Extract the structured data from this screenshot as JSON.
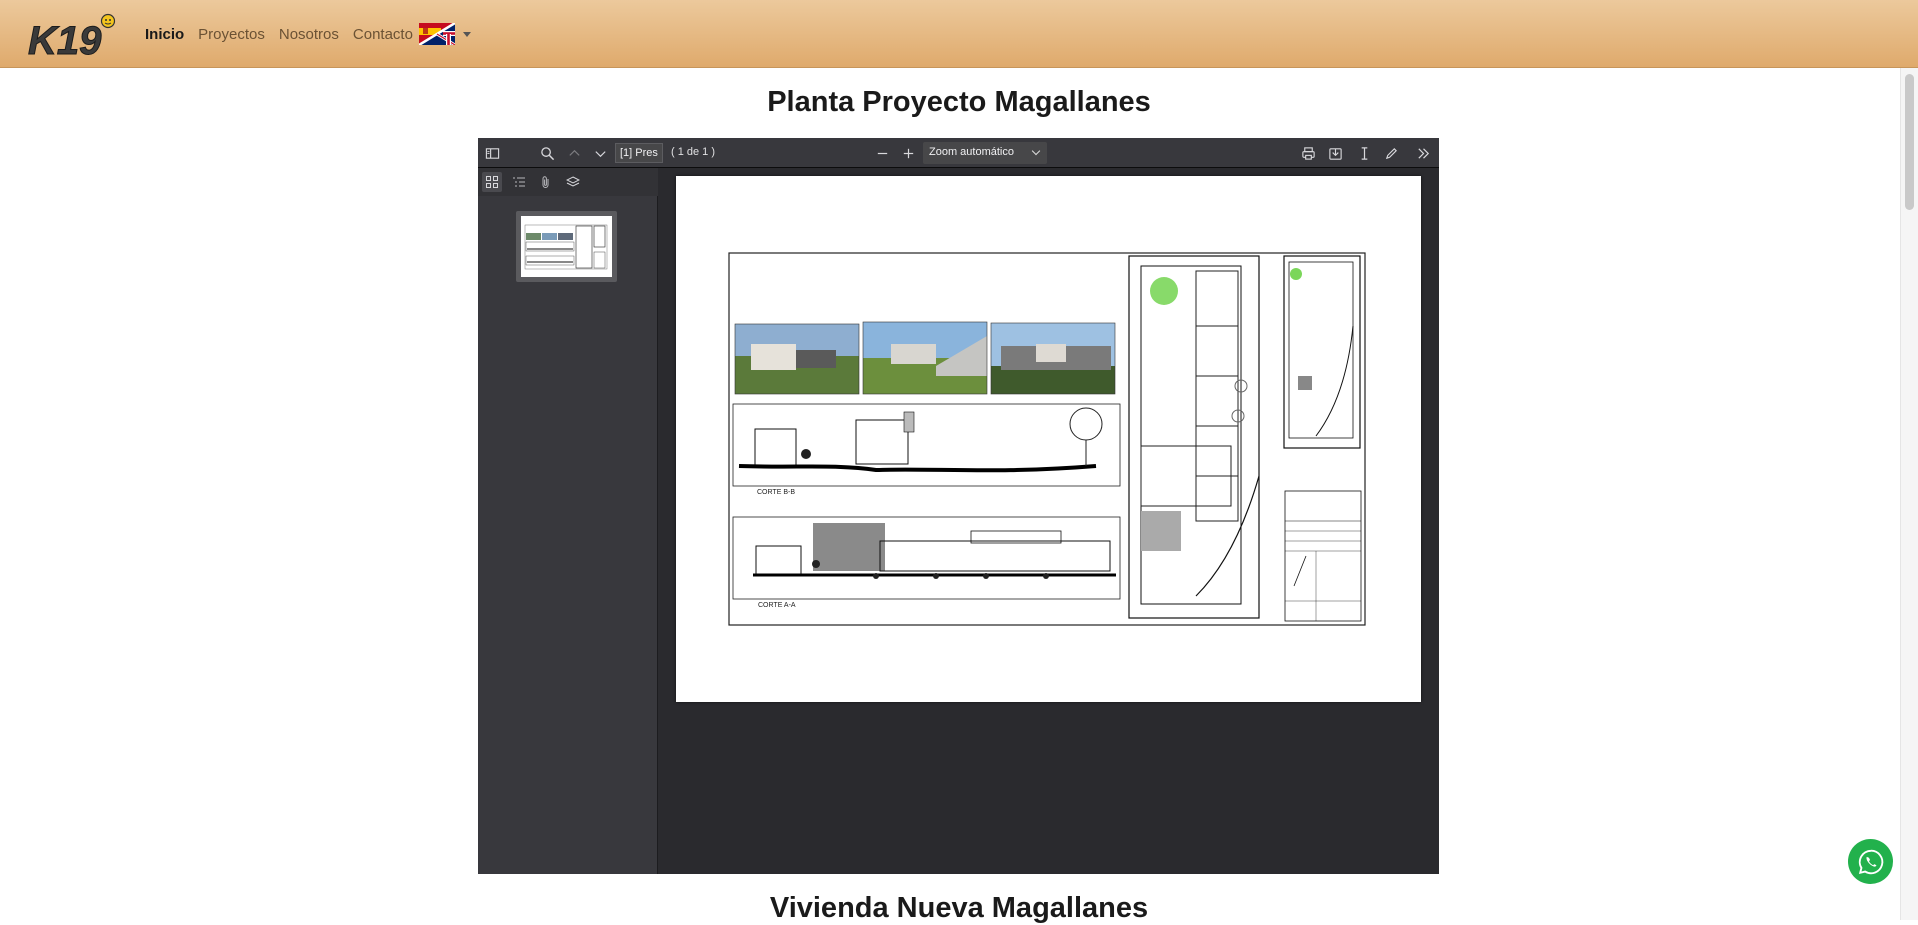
{
  "nav": {
    "logo_text": "K19",
    "links": [
      {
        "label": "Inicio",
        "active": true
      },
      {
        "label": "Proyectos",
        "active": false
      },
      {
        "label": "Nosotros",
        "active": false
      },
      {
        "label": "Contacto",
        "active": false
      }
    ],
    "language_icon": "spain-uk-flag-icon"
  },
  "sections": [
    {
      "title": "Planta Proyecto Magallanes"
    },
    {
      "title": "Vivienda Nueva Magallanes"
    }
  ],
  "pdf_viewer": {
    "page_input_value": "[1] Pres",
    "page_count": "( 1 de 1 )",
    "zoom_label": "Zoom automático",
    "drawing_labels": {
      "section_b": "CORTE B-B",
      "section_a": "CORTE A-A"
    }
  },
  "colors": {
    "navbar_top": "#ecc99c",
    "navbar_bottom": "#dfaa6c",
    "viewer_bg": "#2a2a2e",
    "toolbar_bg": "#38383d",
    "whatsapp": "#22b14c"
  }
}
